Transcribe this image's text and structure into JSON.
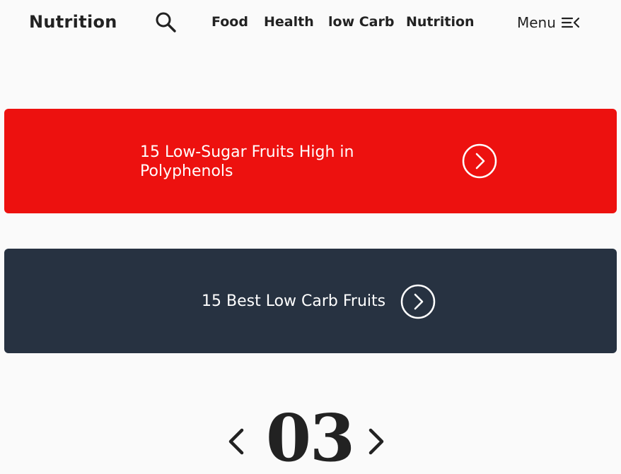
{
  "header": {
    "logo": "Nutrition",
    "nav": [
      {
        "label": "Food"
      },
      {
        "label": "Health"
      },
      {
        "label": "low Carb"
      },
      {
        "label": "Nutrition"
      }
    ],
    "menu_label": "Menu"
  },
  "cards": [
    {
      "title": "15 Low-Sugar Fruits High in Polyphenols",
      "color": "#ed110f"
    },
    {
      "title": "15 Best Low Carb Fruits",
      "color": "#273241"
    }
  ],
  "pager": {
    "current": "03"
  },
  "icons": {
    "search": "search-icon",
    "menu": "menu-icon",
    "arrow": "chevron-right-circle-icon",
    "prev": "chevron-left-icon",
    "next": "chevron-right-icon"
  }
}
